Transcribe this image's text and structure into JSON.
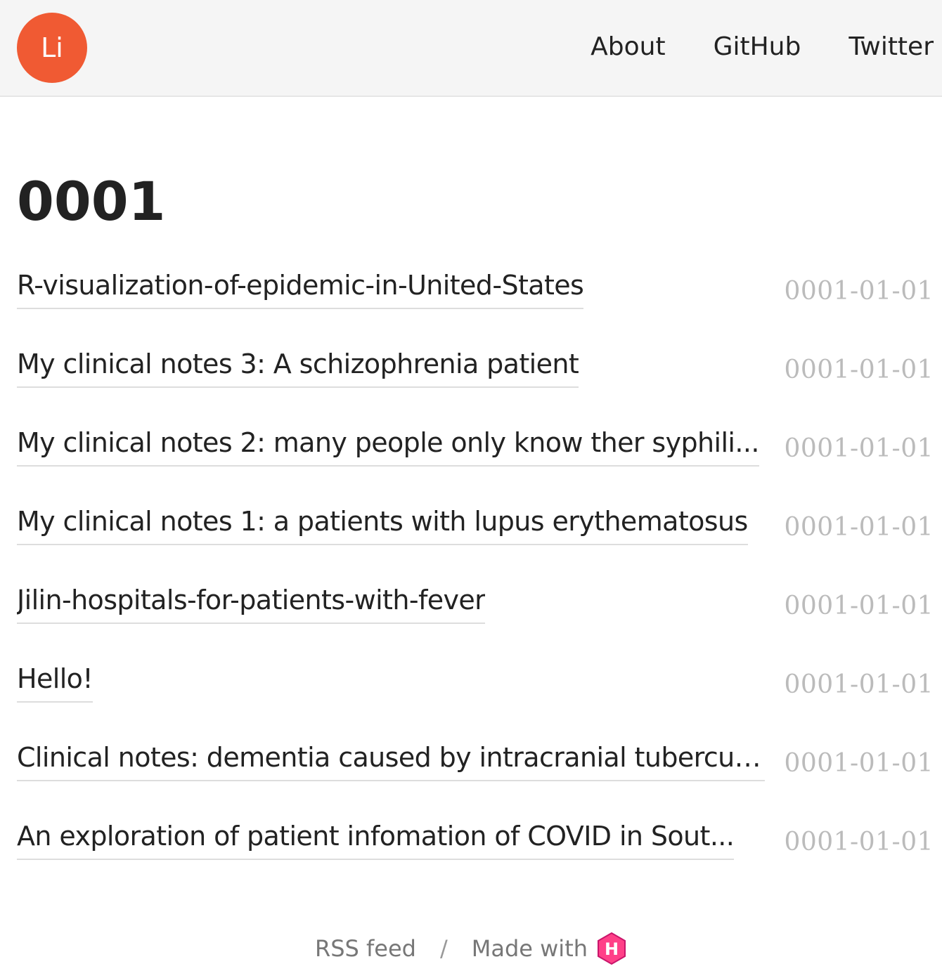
{
  "colors": {
    "logo_bg": "#f05a33",
    "hugo_pink": "#ff4088",
    "date_gray": "#bbbbbb",
    "header_bg": "#f5f5f5"
  },
  "header": {
    "logo_text": "Li",
    "nav": [
      {
        "label": "About"
      },
      {
        "label": "GitHub"
      },
      {
        "label": "Twitter"
      }
    ]
  },
  "main": {
    "title": "0001",
    "posts": [
      {
        "title": "R-visualization-of-epidemic-in-United-States",
        "date": "0001-01-01"
      },
      {
        "title": "My clinical notes 3: A schizophrenia patient",
        "date": "0001-01-01"
      },
      {
        "title": "My clinical notes 2: many people only know ther syphili...",
        "date": "0001-01-01"
      },
      {
        "title": "My clinical notes 1: a patients with lupus erythematosus",
        "date": "0001-01-01"
      },
      {
        "title": "Jilin-hospitals-for-patients-with-fever",
        "date": "0001-01-01"
      },
      {
        "title": "Hello!",
        "date": "0001-01-01"
      },
      {
        "title": "Clinical notes: dementia caused by intracranial tubercul...",
        "date": "0001-01-01"
      },
      {
        "title": "An exploration of patient infomation of COVID in Sout...",
        "date": "0001-01-01"
      }
    ]
  },
  "footer": {
    "rss_label": "RSS feed",
    "separator": "/",
    "made_with": "Made with",
    "hugo_icon_letter": "H",
    "hugo_icon": "hugo-icon"
  }
}
